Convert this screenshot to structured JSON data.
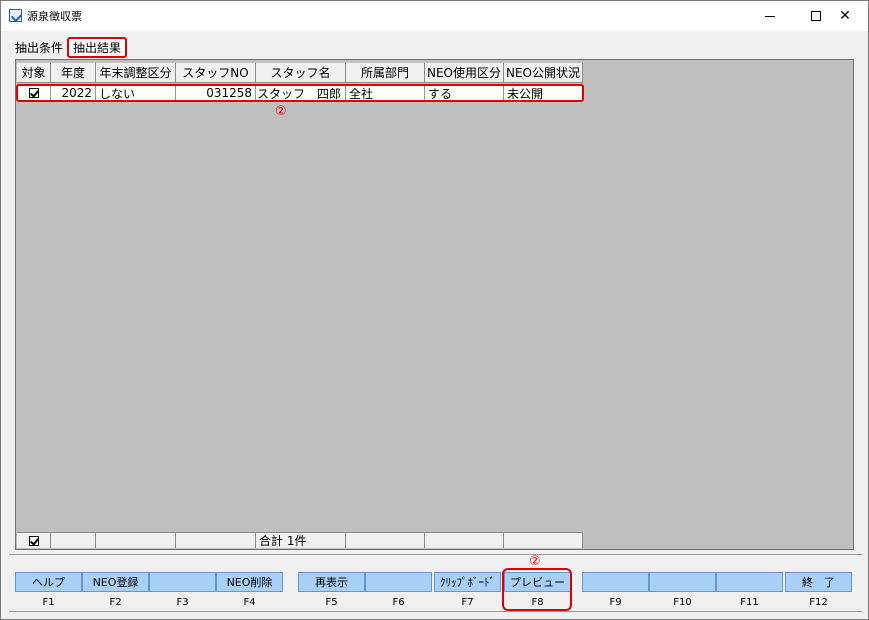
{
  "window": {
    "title": "源泉徴収票",
    "icon": "app-check-icon"
  },
  "tabs": [
    {
      "label": "抽出条件",
      "active": false
    },
    {
      "label": "抽出結果",
      "active": true
    }
  ],
  "table": {
    "columns": [
      "対象",
      "年度",
      "年末調整区分",
      "スタッフNO",
      "スタッフ名",
      "所属部門",
      "NEO使用区分",
      "NEO公開状況"
    ],
    "rows": [
      {
        "target_checked": true,
        "year": "2022",
        "year_end_adjustment": "しない",
        "staff_no": "031258",
        "staff_name": "スタッフ　四郎",
        "department": "全社",
        "neo_usage": "する",
        "neo_status": "未公開"
      }
    ],
    "footer": {
      "total": "合計 1件"
    }
  },
  "annotations": {
    "row_marker": "②",
    "preview_marker": "②"
  },
  "function_keys": [
    {
      "label": "ヘルプ",
      "key": "F1"
    },
    {
      "label": "NEO登録",
      "key": "F2"
    },
    {
      "label": "",
      "key": "F3"
    },
    {
      "label": "NEO削除",
      "key": "F4"
    },
    {
      "label": "再表示",
      "key": "F5"
    },
    {
      "label": "",
      "key": "F6"
    },
    {
      "label": "ｸﾘｯﾌﾟﾎﾞｰﾄﾞ",
      "key": "F7"
    },
    {
      "label": "プレビュー",
      "key": "F8"
    },
    {
      "label": "",
      "key": "F9"
    },
    {
      "label": "",
      "key": "F10"
    },
    {
      "label": "",
      "key": "F11"
    },
    {
      "label": "終　了",
      "key": "F12"
    }
  ],
  "colors": {
    "highlight": "#e00000",
    "fkey_bg": "#a8cff5",
    "grid_bg": "#c0c0c0"
  }
}
